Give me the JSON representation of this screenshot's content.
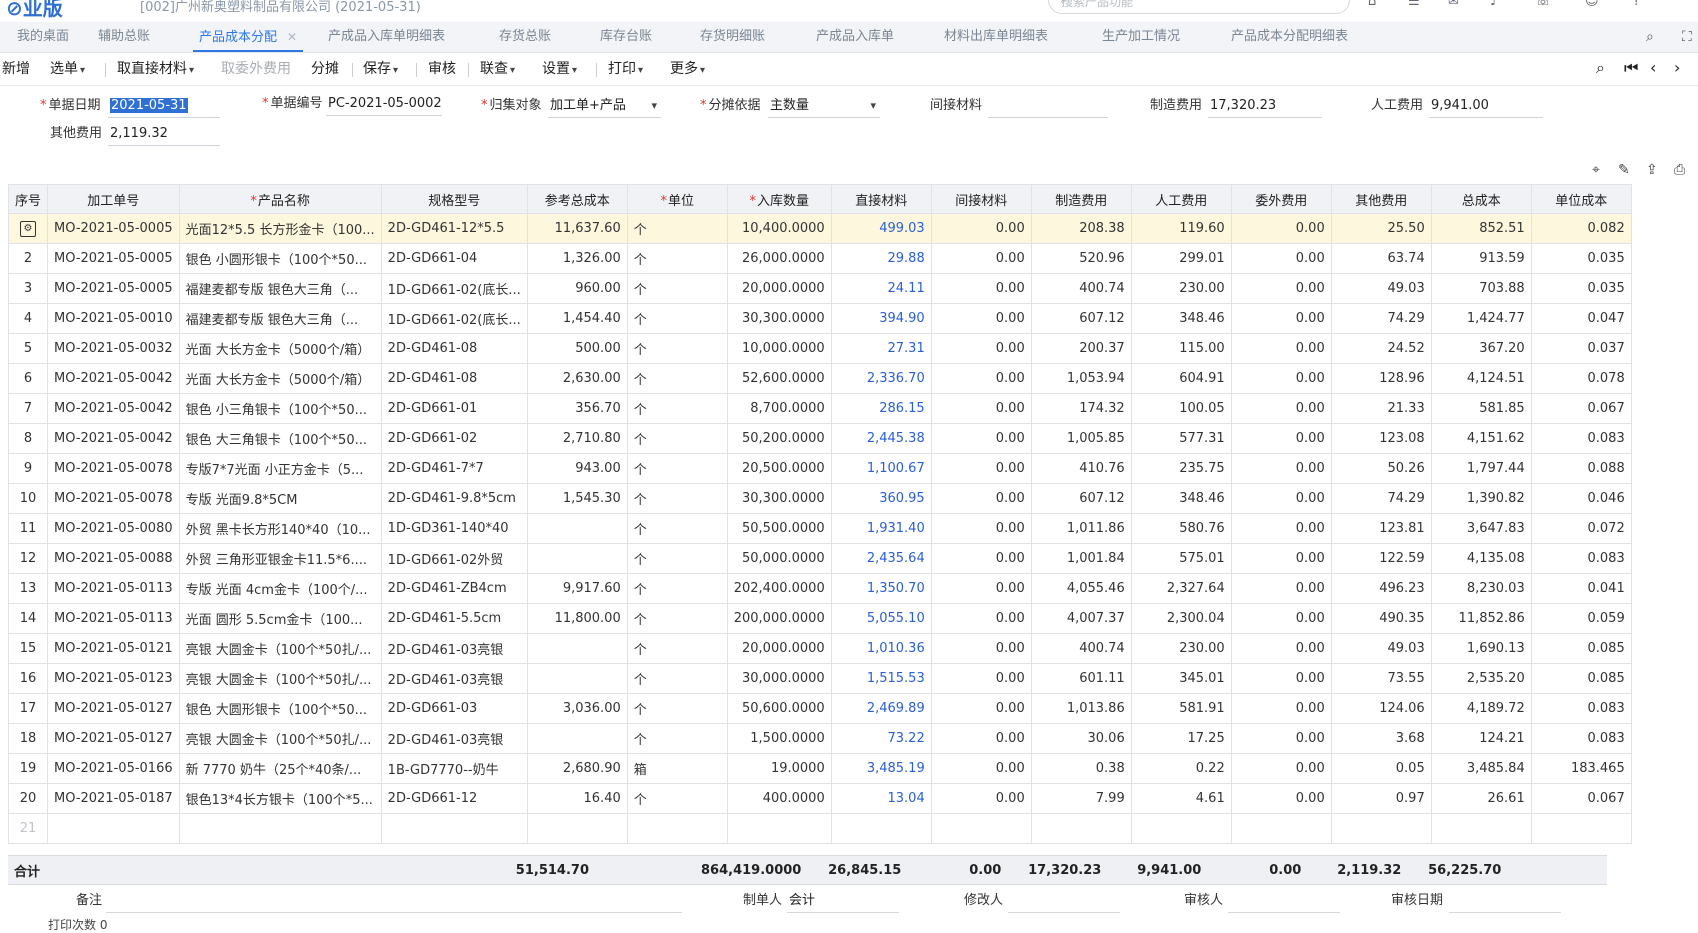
{
  "app": {
    "logo": "⊘业版",
    "org": "[002]广州新奥塑料制品有限公司 (2021-05-31)",
    "search_placeholder": "搜索产品功能"
  },
  "tabs": [
    {
      "label": "我的桌面"
    },
    {
      "label": "辅助总账"
    },
    {
      "label": "产品成本分配",
      "active": true
    },
    {
      "label": "产成品入库单明细表"
    },
    {
      "label": "存货总账"
    },
    {
      "label": "库存台账"
    },
    {
      "label": "存货明细账"
    },
    {
      "label": "产成品入库单"
    },
    {
      "label": "材料出库单明细表"
    },
    {
      "label": "生产加工情况"
    },
    {
      "label": "产品成本分配明细表"
    }
  ],
  "toolbar": {
    "new": "新增",
    "select_bill": "选单",
    "take_material": "取直接材料",
    "take_outsource": "取委外费用",
    "allocate": "分摊",
    "save": "保存",
    "audit": "审核",
    "query": "联查",
    "settings": "设置",
    "print": "打印",
    "more": "更多"
  },
  "form": {
    "date_label": "单据日期",
    "date_value": "2021-05-31",
    "bill_no_label": "单据编号",
    "bill_no_value": "PC-2021-05-0002",
    "collect_label": "归集对象",
    "collect_value": "加工单+产品",
    "basis_label": "分摊依据",
    "basis_value": "主数量",
    "indirect_label": "间接材料",
    "indirect_value": "",
    "mfg_label": "制造费用",
    "mfg_value": "17,320.23",
    "labor_label": "人工费用",
    "labor_value": "9,941.00",
    "other_label": "其他费用",
    "other_value": "2,119.32"
  },
  "grid": {
    "columns": [
      "序号",
      "加工单号",
      "产品名称",
      "规格型号",
      "参考总成本",
      "单位",
      "入库数量",
      "直接材料",
      "间接材料",
      "制造费用",
      "人工费用",
      "委外费用",
      "其他费用",
      "总成本",
      "单位成本"
    ],
    "rows": [
      {
        "no": "1",
        "order": "MO-2021-05-0005",
        "name": "光面12*5.5 长方形金卡（100...",
        "spec": "2D-GD461-12*5.5",
        "ref": "11,637.60",
        "unit": "个",
        "qty": "10,400.0000",
        "direct": "499.03",
        "indirect": "0.00",
        "mfg": "208.38",
        "labor": "119.60",
        "outsource": "0.00",
        "other": "25.50",
        "total": "852.51",
        "unit_cost": "0.082"
      },
      {
        "no": "2",
        "order": "MO-2021-05-0005",
        "name": "银色 小圆形银卡（100个*50...",
        "spec": "2D-GD661-04",
        "ref": "1,326.00",
        "unit": "个",
        "qty": "26,000.0000",
        "direct": "29.88",
        "indirect": "0.00",
        "mfg": "520.96",
        "labor": "299.01",
        "outsource": "0.00",
        "other": "63.74",
        "total": "913.59",
        "unit_cost": "0.035"
      },
      {
        "no": "3",
        "order": "MO-2021-05-0005",
        "name": "福建麦都专版 银色大三角（...",
        "spec": "1D-GD661-02(底长...",
        "ref": "960.00",
        "unit": "个",
        "qty": "20,000.0000",
        "direct": "24.11",
        "indirect": "0.00",
        "mfg": "400.74",
        "labor": "230.00",
        "outsource": "0.00",
        "other": "49.03",
        "total": "703.88",
        "unit_cost": "0.035"
      },
      {
        "no": "4",
        "order": "MO-2021-05-0010",
        "name": "福建麦都专版 银色大三角（...",
        "spec": "1D-GD661-02(底长...",
        "ref": "1,454.40",
        "unit": "个",
        "qty": "30,300.0000",
        "direct": "394.90",
        "indirect": "0.00",
        "mfg": "607.12",
        "labor": "348.46",
        "outsource": "0.00",
        "other": "74.29",
        "total": "1,424.77",
        "unit_cost": "0.047"
      },
      {
        "no": "5",
        "order": "MO-2021-05-0032",
        "name": "光面 大长方金卡（5000个/箱）",
        "spec": "2D-GD461-08",
        "ref": "500.00",
        "unit": "个",
        "qty": "10,000.0000",
        "direct": "27.31",
        "indirect": "0.00",
        "mfg": "200.37",
        "labor": "115.00",
        "outsource": "0.00",
        "other": "24.52",
        "total": "367.20",
        "unit_cost": "0.037"
      },
      {
        "no": "6",
        "order": "MO-2021-05-0042",
        "name": "光面 大长方金卡（5000个/箱）",
        "spec": "2D-GD461-08",
        "ref": "2,630.00",
        "unit": "个",
        "qty": "52,600.0000",
        "direct": "2,336.70",
        "indirect": "0.00",
        "mfg": "1,053.94",
        "labor": "604.91",
        "outsource": "0.00",
        "other": "128.96",
        "total": "4,124.51",
        "unit_cost": "0.078"
      },
      {
        "no": "7",
        "order": "MO-2021-05-0042",
        "name": "银色 小三角银卡（100个*50...",
        "spec": "2D-GD661-01",
        "ref": "356.70",
        "unit": "个",
        "qty": "8,700.0000",
        "direct": "286.15",
        "indirect": "0.00",
        "mfg": "174.32",
        "labor": "100.05",
        "outsource": "0.00",
        "other": "21.33",
        "total": "581.85",
        "unit_cost": "0.067"
      },
      {
        "no": "8",
        "order": "MO-2021-05-0042",
        "name": "银色 大三角银卡（100个*50...",
        "spec": "2D-GD661-02",
        "ref": "2,710.80",
        "unit": "个",
        "qty": "50,200.0000",
        "direct": "2,445.38",
        "indirect": "0.00",
        "mfg": "1,005.85",
        "labor": "577.31",
        "outsource": "0.00",
        "other": "123.08",
        "total": "4,151.62",
        "unit_cost": "0.083"
      },
      {
        "no": "9",
        "order": "MO-2021-05-0078",
        "name": "专版7*7光面 小正方金卡（5...",
        "spec": "2D-GD461-7*7",
        "ref": "943.00",
        "unit": "个",
        "qty": "20,500.0000",
        "direct": "1,100.67",
        "indirect": "0.00",
        "mfg": "410.76",
        "labor": "235.75",
        "outsource": "0.00",
        "other": "50.26",
        "total": "1,797.44",
        "unit_cost": "0.088"
      },
      {
        "no": "10",
        "order": "MO-2021-05-0078",
        "name": "专版 光面9.8*5CM",
        "spec": "2D-GD461-9.8*5cm",
        "ref": "1,545.30",
        "unit": "个",
        "qty": "30,300.0000",
        "direct": "360.95",
        "indirect": "0.00",
        "mfg": "607.12",
        "labor": "348.46",
        "outsource": "0.00",
        "other": "74.29",
        "total": "1,390.82",
        "unit_cost": "0.046"
      },
      {
        "no": "11",
        "order": "MO-2021-05-0080",
        "name": "外贸 黑卡长方形140*40（10...",
        "spec": "1D-GD361-140*40",
        "ref": "",
        "unit": "个",
        "qty": "50,500.0000",
        "direct": "1,931.40",
        "indirect": "0.00",
        "mfg": "1,011.86",
        "labor": "580.76",
        "outsource": "0.00",
        "other": "123.81",
        "total": "3,647.83",
        "unit_cost": "0.072"
      },
      {
        "no": "12",
        "order": "MO-2021-05-0088",
        "name": "外贸 三角形亚银金卡11.5*6....",
        "spec": "1D-GD661-02外贸",
        "ref": "",
        "unit": "个",
        "qty": "50,000.0000",
        "direct": "2,435.64",
        "indirect": "0.00",
        "mfg": "1,001.84",
        "labor": "575.01",
        "outsource": "0.00",
        "other": "122.59",
        "total": "4,135.08",
        "unit_cost": "0.083"
      },
      {
        "no": "13",
        "order": "MO-2021-05-0113",
        "name": "专版 光面 4cm金卡（100个/...",
        "spec": "2D-GD461-ZB4cm",
        "ref": "9,917.60",
        "unit": "个",
        "qty": "202,400.0000",
        "direct": "1,350.70",
        "indirect": "0.00",
        "mfg": "4,055.46",
        "labor": "2,327.64",
        "outsource": "0.00",
        "other": "496.23",
        "total": "8,230.03",
        "unit_cost": "0.041"
      },
      {
        "no": "14",
        "order": "MO-2021-05-0113",
        "name": "光面 圆形 5.5cm金卡（100...",
        "spec": "2D-GD461-5.5cm",
        "ref": "11,800.00",
        "unit": "个",
        "qty": "200,000.0000",
        "direct": "5,055.10",
        "indirect": "0.00",
        "mfg": "4,007.37",
        "labor": "2,300.04",
        "outsource": "0.00",
        "other": "490.35",
        "total": "11,852.86",
        "unit_cost": "0.059"
      },
      {
        "no": "15",
        "order": "MO-2021-05-0121",
        "name": "亮银 大圆金卡（100个*50扎/...",
        "spec": "2D-GD461-03亮银",
        "ref": "",
        "unit": "个",
        "qty": "20,000.0000",
        "direct": "1,010.36",
        "indirect": "0.00",
        "mfg": "400.74",
        "labor": "230.00",
        "outsource": "0.00",
        "other": "49.03",
        "total": "1,690.13",
        "unit_cost": "0.085"
      },
      {
        "no": "16",
        "order": "MO-2021-05-0123",
        "name": "亮银 大圆金卡（100个*50扎/...",
        "spec": "2D-GD461-03亮银",
        "ref": "",
        "unit": "个",
        "qty": "30,000.0000",
        "direct": "1,515.53",
        "indirect": "0.00",
        "mfg": "601.11",
        "labor": "345.01",
        "outsource": "0.00",
        "other": "73.55",
        "total": "2,535.20",
        "unit_cost": "0.085"
      },
      {
        "no": "17",
        "order": "MO-2021-05-0127",
        "name": "银色 大圆形银卡（100个*50...",
        "spec": "2D-GD661-03",
        "ref": "3,036.00",
        "unit": "个",
        "qty": "50,600.0000",
        "direct": "2,469.89",
        "indirect": "0.00",
        "mfg": "1,013.86",
        "labor": "581.91",
        "outsource": "0.00",
        "other": "124.06",
        "total": "4,189.72",
        "unit_cost": "0.083"
      },
      {
        "no": "18",
        "order": "MO-2021-05-0127",
        "name": "亮银 大圆金卡（100个*50扎/...",
        "spec": "2D-GD461-03亮银",
        "ref": "",
        "unit": "个",
        "qty": "1,500.0000",
        "direct": "73.22",
        "indirect": "0.00",
        "mfg": "30.06",
        "labor": "17.25",
        "outsource": "0.00",
        "other": "3.68",
        "total": "124.21",
        "unit_cost": "0.083"
      },
      {
        "no": "19",
        "order": "MO-2021-05-0166",
        "name": "新 7770 奶牛（25个*40条/...",
        "spec": "1B-GD7770--奶牛",
        "ref": "2,680.90",
        "unit": "箱",
        "qty": "19.0000",
        "direct": "3,485.19",
        "indirect": "0.00",
        "mfg": "0.38",
        "labor": "0.22",
        "outsource": "0.00",
        "other": "0.05",
        "total": "3,485.84",
        "unit_cost": "183.465"
      },
      {
        "no": "20",
        "order": "MO-2021-05-0187",
        "name": "银色13*4长方银卡（100个*5...",
        "spec": "2D-GD661-12",
        "ref": "16.40",
        "unit": "个",
        "qty": "400.0000",
        "direct": "13.04",
        "indirect": "0.00",
        "mfg": "7.99",
        "labor": "4.61",
        "outsource": "0.00",
        "other": "0.97",
        "total": "26.61",
        "unit_cost": "0.067"
      }
    ],
    "empty_row_no": "21"
  },
  "totals": {
    "label": "合计",
    "ref": "51,514.70",
    "qty": "864,419.0000",
    "direct": "26,845.15",
    "indirect": "0.00",
    "mfg": "17,320.23",
    "labor": "9,941.00",
    "outsource": "0.00",
    "other": "2,119.32",
    "total": "56,225.70"
  },
  "footer": {
    "remark_label": "备注",
    "maker_label": "制单人",
    "maker_value": "会计",
    "modifier_label": "修改人",
    "auditor_label": "审核人",
    "audit_date_label": "审核日期",
    "print_count": "打印次数 0"
  }
}
